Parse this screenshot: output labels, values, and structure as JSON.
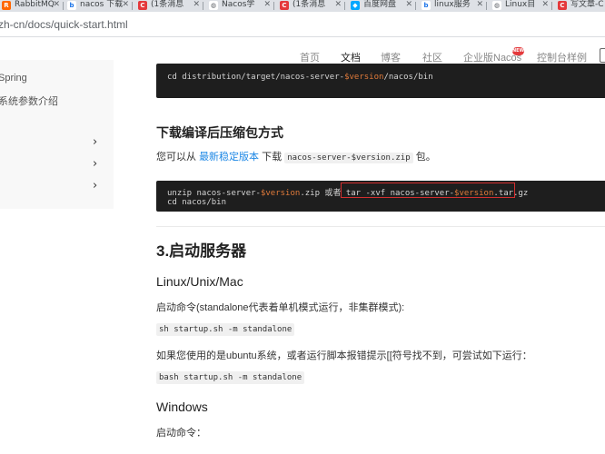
{
  "browser": {
    "tabs": [
      {
        "title": "RabbitMQ",
        "icon": "rabbitmq-icon",
        "color": "#f60"
      },
      {
        "title": "nacos 下载",
        "icon": "bing-icon",
        "color": "#1a73e8"
      },
      {
        "title": "(1条消息",
        "icon": "csdn-icon",
        "color": "#e4393c"
      },
      {
        "title": "Nacos学",
        "icon": "globe-icon",
        "color": "#5f6368"
      },
      {
        "title": "(1条消息",
        "icon": "csdn-icon",
        "color": "#e4393c"
      },
      {
        "title": "百度网盘",
        "icon": "baidu-netdisk-icon",
        "color": "#06a7ff"
      },
      {
        "title": "linux服务",
        "icon": "bing-icon",
        "color": "#1a73e8"
      },
      {
        "title": "Linux目",
        "icon": "globe-icon",
        "color": "#5f6368"
      },
      {
        "title": "写文章-C",
        "icon": "csdn-icon",
        "color": "#e4393c"
      }
    ],
    "url": "zh-cn/docs/quick-start.html"
  },
  "header": {
    "nav": [
      "首页",
      "文档",
      "博客",
      "社区",
      "企业版Nacos",
      "控制台样例"
    ],
    "new_badge": "NEW"
  },
  "sidebar": {
    "items": [
      "Spring",
      "系统参数介绍"
    ]
  },
  "content": {
    "code1": {
      "prefix": "cd distribution/target/nacos-server-",
      "var": "$version",
      "suffix": "/nacos/bin"
    },
    "section_download_title": "下载编译后压缩包方式",
    "download_para": {
      "before": "您可以从 ",
      "link": "最新稳定版本",
      "middle": " 下载 ",
      "code": "nacos-server-$version.zip",
      "after": " 包。"
    },
    "code2": {
      "l1_a": "unzip nacos-server-",
      "l1_var": "$version",
      "l1_b": ".zip ",
      "l1_or": "或者 ",
      "l1_c": "tar -xvf nacos-server-",
      "l1_var2": "$version",
      "l1_d": ".tar.gz",
      "l2": "cd nacos/bin"
    },
    "section_start_title": "3.启动服务器",
    "linux_title": "Linux/Unix/Mac",
    "start_cmd_desc": "启动命令(standalone代表着单机模式运行，非集群模式):",
    "cmd_sh": "sh startup.sh -m standalone",
    "ubuntu_desc": "如果您使用的是ubuntu系统，或者运行脚本报错提示[[符号找不到，可尝试如下运行：",
    "cmd_bash": "bash startup.sh -m standalone",
    "windows_title": "Windows",
    "win_start_desc": "启动命令："
  },
  "colors": {
    "link": "#1e88e5",
    "highlight_border": "#d32f2f",
    "code_bg": "#1e1e1e",
    "var": "#e07a3a"
  }
}
